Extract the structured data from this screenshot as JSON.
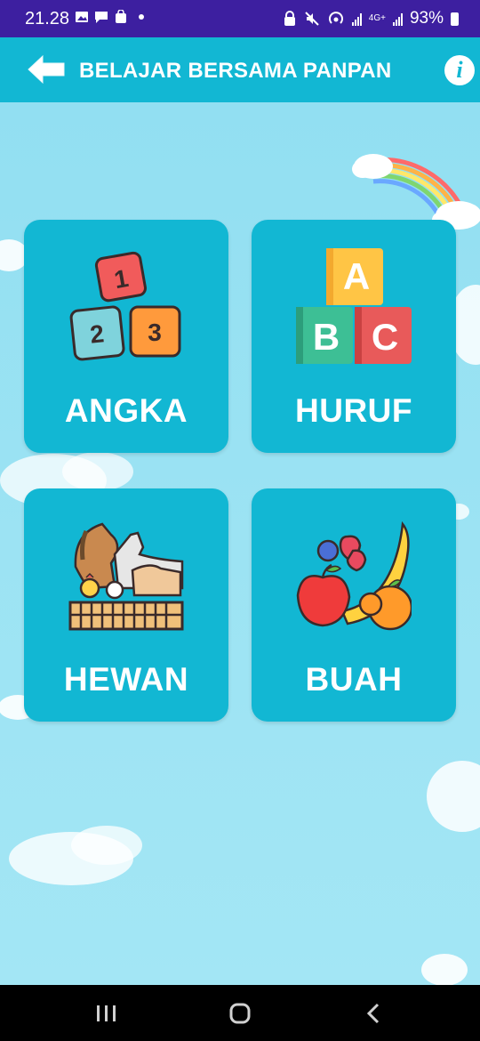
{
  "status_bar": {
    "time": "21.28",
    "battery": "93%",
    "network": "4G+",
    "left_icons": [
      "image-icon",
      "message-icon",
      "shopping-icon"
    ],
    "right_icons": [
      "lock-icon",
      "mute-icon",
      "hotspot-icon",
      "signal-icon",
      "battery-icon"
    ]
  },
  "app_bar": {
    "title": "BELAJAR BERSAMA PANPAN",
    "back_icon": "arrow-left-icon",
    "info_icon": "info-icon",
    "info_glyph": "i"
  },
  "menu": {
    "items": [
      {
        "label": "ANGKA",
        "icon": "number-blocks-icon"
      },
      {
        "label": "HURUF",
        "icon": "letter-blocks-icon"
      },
      {
        "label": "HEWAN",
        "icon": "farm-animals-icon"
      },
      {
        "label": "BUAH",
        "icon": "fruits-icon"
      }
    ]
  },
  "number_blocks": [
    "1",
    "2",
    "3"
  ],
  "letter_blocks": [
    "A",
    "B",
    "C"
  ],
  "nav_bar": {
    "icons": [
      "recent-apps-icon",
      "home-icon",
      "back-icon"
    ]
  },
  "colors": {
    "status_bar": "#3d1fa0",
    "app_bar": "#12b7d3",
    "tile": "#12b7d3",
    "background": "#92dff2"
  }
}
